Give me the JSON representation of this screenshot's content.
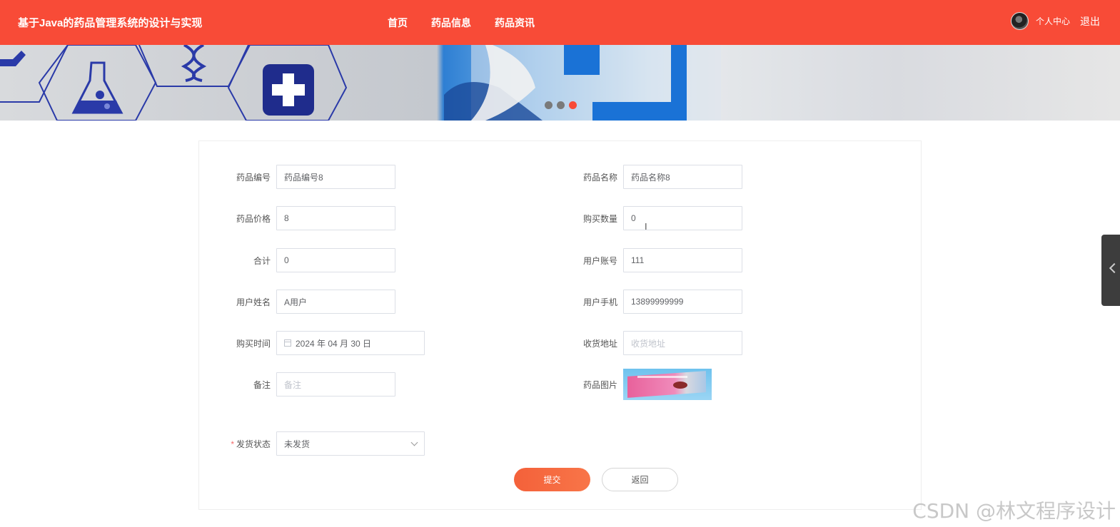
{
  "header": {
    "site_title": "基于Java的药品管理系统的设计与实现",
    "nav": [
      "首页",
      "药品信息",
      "药品资讯"
    ],
    "user_center": "个人中心",
    "logout": "退出"
  },
  "carousel": {
    "slides": 3,
    "active_index": 2
  },
  "form": {
    "drug_code": {
      "label": "药品编号",
      "value": "药品编号8"
    },
    "drug_name": {
      "label": "药品名称",
      "value": "药品名称8"
    },
    "drug_price": {
      "label": "药品价格",
      "value": "8"
    },
    "buy_quantity": {
      "label": "购买数量",
      "value": "0"
    },
    "total": {
      "label": "合计",
      "value": "0"
    },
    "user_account": {
      "label": "用户账号",
      "value": "111"
    },
    "user_name": {
      "label": "用户姓名",
      "value": "A用户"
    },
    "user_phone": {
      "label": "用户手机",
      "value": "13899999999"
    },
    "buy_time": {
      "label": "购买时间",
      "value": "2024 年 04 月 30 日"
    },
    "address": {
      "label": "收货地址",
      "placeholder": "收货地址"
    },
    "remark": {
      "label": "备注",
      "placeholder": "备注"
    },
    "drug_image": {
      "label": "药品图片"
    },
    "ship_status": {
      "label": "发货状态",
      "required_mark": "*",
      "value": "未发货"
    }
  },
  "buttons": {
    "submit": "提交",
    "back": "返回"
  },
  "watermark": "CSDN @林文程序设计",
  "colors": {
    "accent": "#f84b37",
    "button": "#f4613a"
  }
}
